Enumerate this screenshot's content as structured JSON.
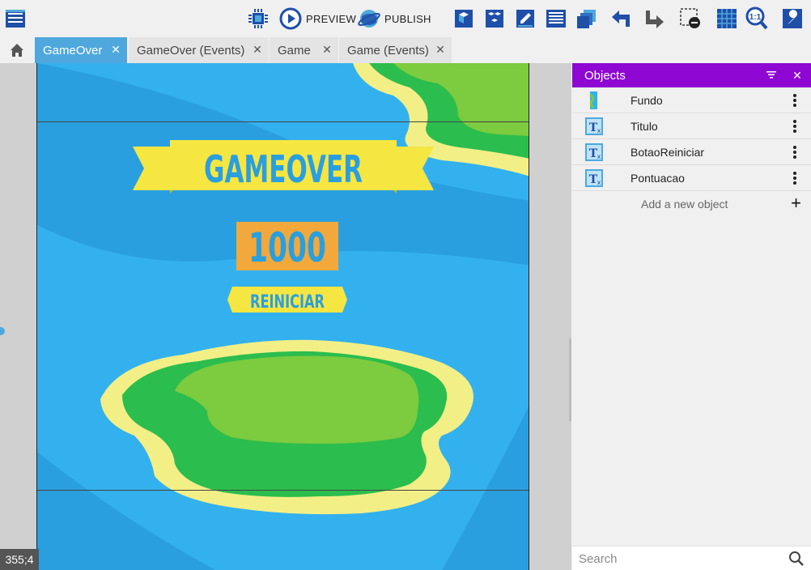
{
  "toolbar": {
    "preview_label": "PREVIEW",
    "publish_label": "PUBLISH"
  },
  "tabs": [
    {
      "label": "GameOver",
      "active": true
    },
    {
      "label": "GameOver (Events)",
      "active": false
    },
    {
      "label": "Game",
      "active": false
    },
    {
      "label": "Game (Events)",
      "active": false
    }
  ],
  "scene": {
    "title_text": "GAMEOVER",
    "score_text": "1000",
    "button_text": "REINICIAR",
    "cursor_coords": "355;4",
    "colors": {
      "water": "#33b1ee",
      "water_dark": "#2a9fdf",
      "sand": "#f2ef86",
      "grass_dark": "#2bbd4e",
      "grass_light": "#7dcb3e",
      "banner": "#f5e642",
      "score_bg": "#f2a83b"
    }
  },
  "objects_panel": {
    "title": "Objects",
    "items": [
      {
        "name": "Fundo",
        "icon": "sprite-icon"
      },
      {
        "name": "Titulo",
        "icon": "text-object-icon"
      },
      {
        "name": "BotaoReiniciar",
        "icon": "text-object-icon"
      },
      {
        "name": "Pontuacao",
        "icon": "text-object-icon"
      }
    ],
    "add_label": "Add a new object",
    "search_placeholder": "Search"
  }
}
